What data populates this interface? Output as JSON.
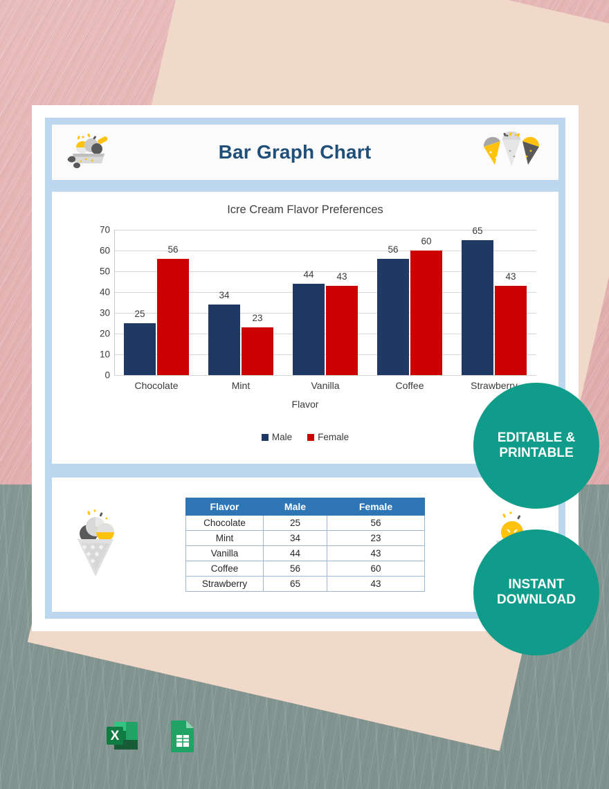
{
  "document": {
    "title": "Bar Graph Chart",
    "header_icon_left": "ice-cream-bowl-icon",
    "header_icon_right": "ice-cream-cones-icon"
  },
  "chart_data": {
    "type": "bar",
    "title": "Icre Cream Flavor Preferences",
    "xlabel": "Flavor",
    "ylabel": "",
    "ylim": [
      0,
      70
    ],
    "ytick_step": 10,
    "yticks": [
      "0",
      "10",
      "20",
      "30",
      "40",
      "50",
      "60",
      "70"
    ],
    "grid": true,
    "legend_position": "bottom",
    "categories": [
      "Chocolate",
      "Mint",
      "Vanilla",
      "Coffee",
      "Strawberry"
    ],
    "series": [
      {
        "name": "Male",
        "color": "#1F3864",
        "values": [
          25,
          34,
          44,
          56,
          65
        ]
      },
      {
        "name": "Female",
        "color": "#CC0000",
        "values": [
          56,
          23,
          43,
          60,
          43
        ]
      }
    ]
  },
  "table": {
    "headers": [
      "Flavor",
      "Male",
      "Female"
    ],
    "rows": [
      [
        "Chocolate",
        "25",
        "56"
      ],
      [
        "Mint",
        "34",
        "23"
      ],
      [
        "Vanilla",
        "44",
        "43"
      ],
      [
        "Coffee",
        "56",
        "60"
      ],
      [
        "Strawberry",
        "65",
        "43"
      ]
    ],
    "icon_left": "ice-cream-cone-icon",
    "icon_right": "ice-cream-cone-icon"
  },
  "badges": [
    {
      "name": "editable-printable-badge",
      "line1": "EDITABLE &",
      "line2": "PRINTABLE",
      "color": "#109C8A"
    },
    {
      "name": "instant-download-badge",
      "line1": "INSTANT",
      "line2": "DOWNLOAD",
      "color": "#109C8A"
    }
  ],
  "app_icons": [
    {
      "name": "microsoft-excel-icon",
      "label": "X"
    },
    {
      "name": "google-sheets-icon",
      "label": ""
    }
  ],
  "colors": {
    "title_blue": "#1F4E79",
    "panel_blue": "#BDD7EE",
    "table_header_blue": "#2E75B6",
    "male_navy": "#1F3864",
    "female_red": "#CC0000",
    "badge_teal": "#109C8A",
    "bg_pink": "#E4B3B3",
    "bg_peach": "#F0D9C9",
    "bg_gray_green": "#869894"
  }
}
